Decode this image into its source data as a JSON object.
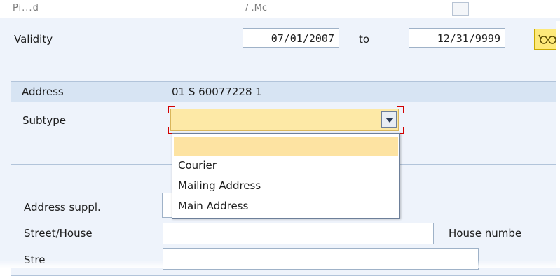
{
  "header": {
    "fragment_left": "Pi...d",
    "fragment_mid": "/ .Mc"
  },
  "validity": {
    "label": "Validity",
    "from": "07/01/2007",
    "to_label": "to",
    "to": "12/31/9999"
  },
  "address": {
    "header_label": "Address",
    "header_value": "01 S  60077228 1",
    "subtype_label": "Subtype",
    "subtype_value": "",
    "options": [
      "",
      "Courier",
      "Mailing Address",
      "Main Address"
    ]
  },
  "fields": {
    "address_suppl_label": "Address suppl.",
    "street_house_label": "Street/House",
    "house_number_label": "House numbe",
    "street2_label": "Stre"
  },
  "colors": {
    "selected_bg": "#fde9a6",
    "focus_corner": "#d20000",
    "panel_header": "#d7e4f3"
  }
}
